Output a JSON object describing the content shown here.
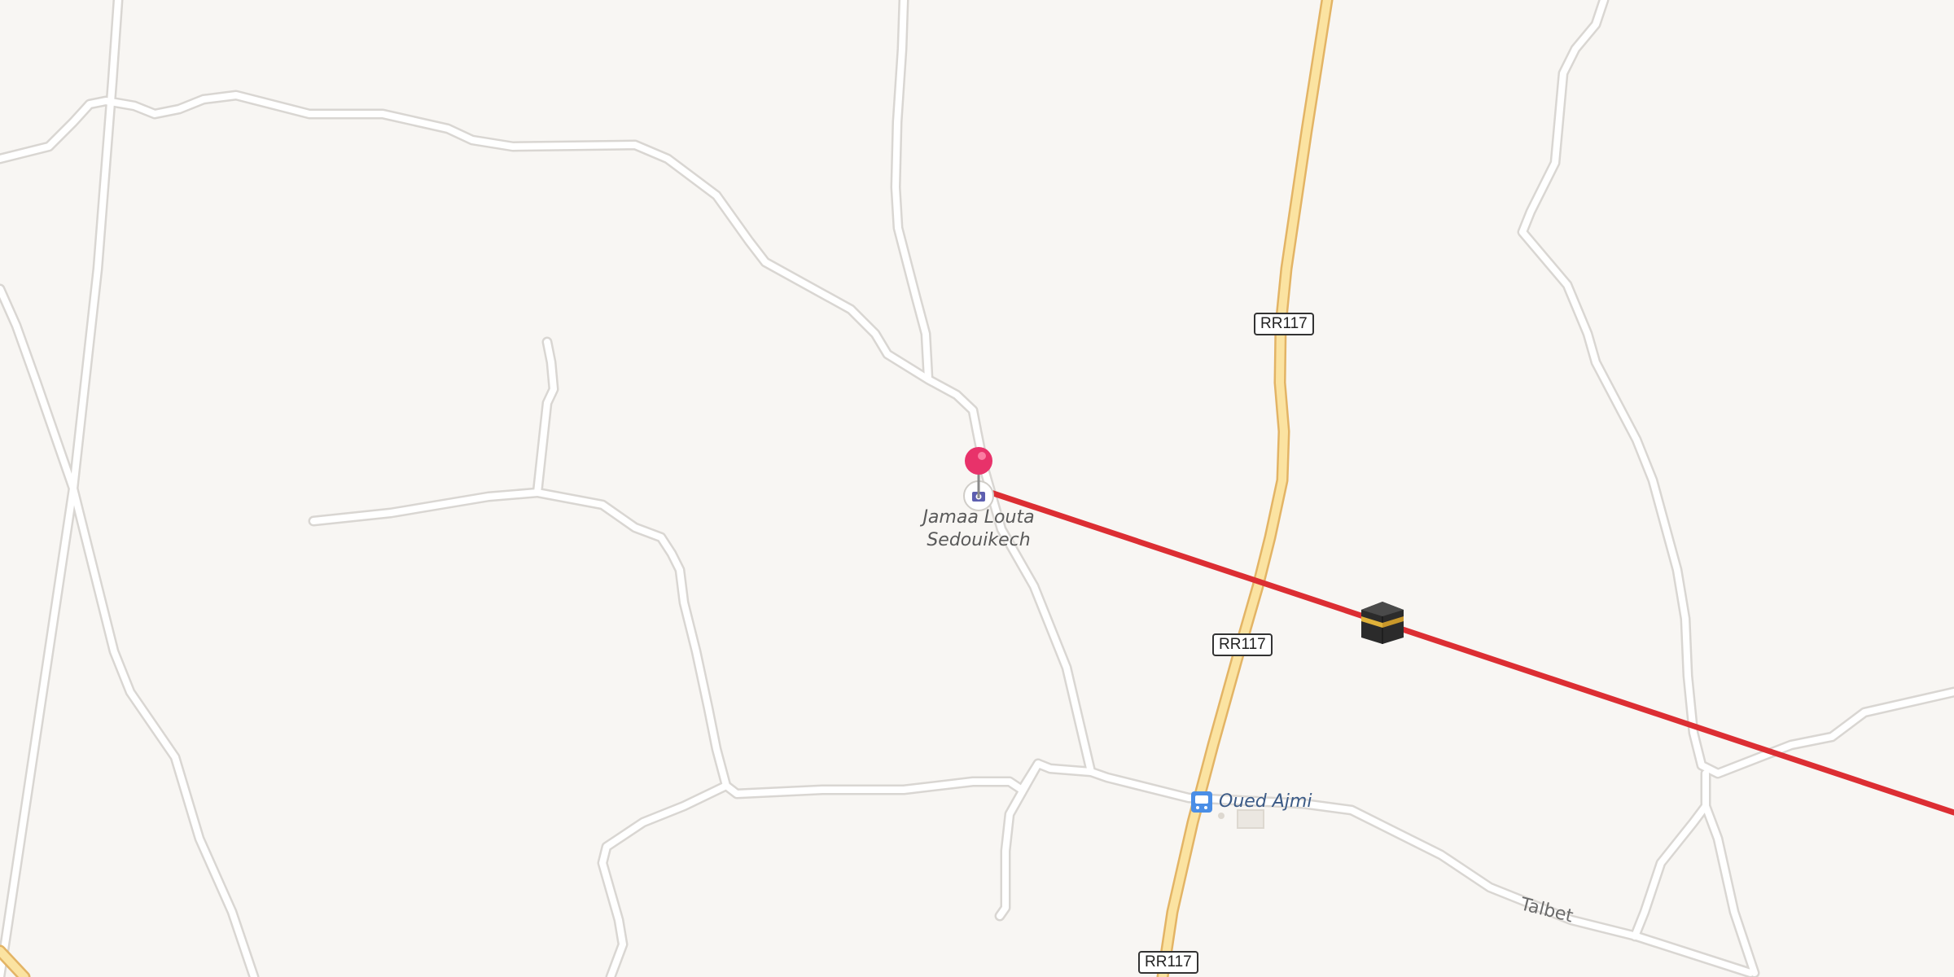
{
  "map": {
    "poi": {
      "name_line1": "Jamaa Louta",
      "name_line2": "Sedouikech",
      "icon": "mosque-icon"
    },
    "transit": {
      "name": "Oued Ajmi",
      "icon": "bus-stop-icon"
    },
    "street": {
      "name": "Talbet"
    },
    "route_shields": [
      "RR117",
      "RR117",
      "RR117"
    ],
    "markers": {
      "pin": {
        "icon": "location-pin-icon",
        "color": "#e8326a"
      },
      "qibla": {
        "icon": "kaaba-icon"
      }
    },
    "colors": {
      "background": "#f8f6f3",
      "qibla_line": "#dc2e33",
      "highway": "#fbe3a1",
      "road": "#ffffff"
    }
  }
}
